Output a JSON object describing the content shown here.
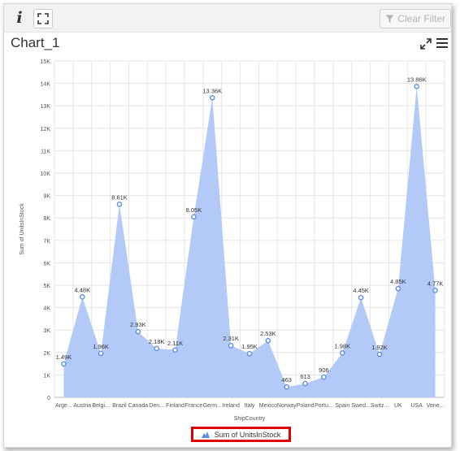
{
  "toolbar": {
    "info_icon": "i",
    "fullscreen_icon": "fullscreen-icon",
    "clear_filter_label": "Clear Filter"
  },
  "chart_title": "Chart_1",
  "chart_data": {
    "type": "area",
    "categories": [
      "Arge...",
      "Austria",
      "Belgi...",
      "Brazil",
      "Canada",
      "Den...",
      "Finland",
      "France",
      "Germ...",
      "Ireland",
      "Italy",
      "Mexico",
      "Norway",
      "Poland",
      "Portu...",
      "Spain",
      "Swed...",
      "Switz...",
      "UK",
      "USA",
      "Vene..."
    ],
    "series": [
      {
        "name": "Sum of UnitsInStock",
        "values": [
          1490,
          4480,
          1960,
          8610,
          2930,
          2180,
          2110,
          8050,
          13360,
          2310,
          1950,
          2530,
          463,
          613,
          906,
          1980,
          4450,
          1920,
          4850,
          13860,
          4770
        ],
        "labels": [
          "1.49K",
          "4.48K",
          "1.96K",
          "8.61K",
          "2.93K",
          "2.18K",
          "2.11K",
          "8.05K",
          "13.36K",
          "2.31K",
          "1.95K",
          "2.53K",
          "463",
          "613",
          "906",
          "1.98K",
          "4.45K",
          "1.92K",
          "4.85K",
          "13.86K",
          "4.77K"
        ],
        "color": "#b3c9f7",
        "marker_color": "#5b8fe6"
      }
    ],
    "xlabel": "ShipCountry",
    "ylabel": "Sum of UnitsInStock",
    "ylim": [
      0,
      15000
    ],
    "yticks": [
      0,
      1000,
      2000,
      3000,
      4000,
      5000,
      6000,
      7000,
      8000,
      9000,
      10000,
      11000,
      12000,
      13000,
      14000,
      15000
    ],
    "ytick_labels": [
      "0",
      "1K",
      "2K",
      "3K",
      "4K",
      "5K",
      "6K",
      "7K",
      "8K",
      "9K",
      "10K",
      "11K",
      "12K",
      "13K",
      "14K",
      "15K"
    ],
    "grid": true,
    "legend": "bottom"
  },
  "legend_label": "Sum of UnitsInStock"
}
